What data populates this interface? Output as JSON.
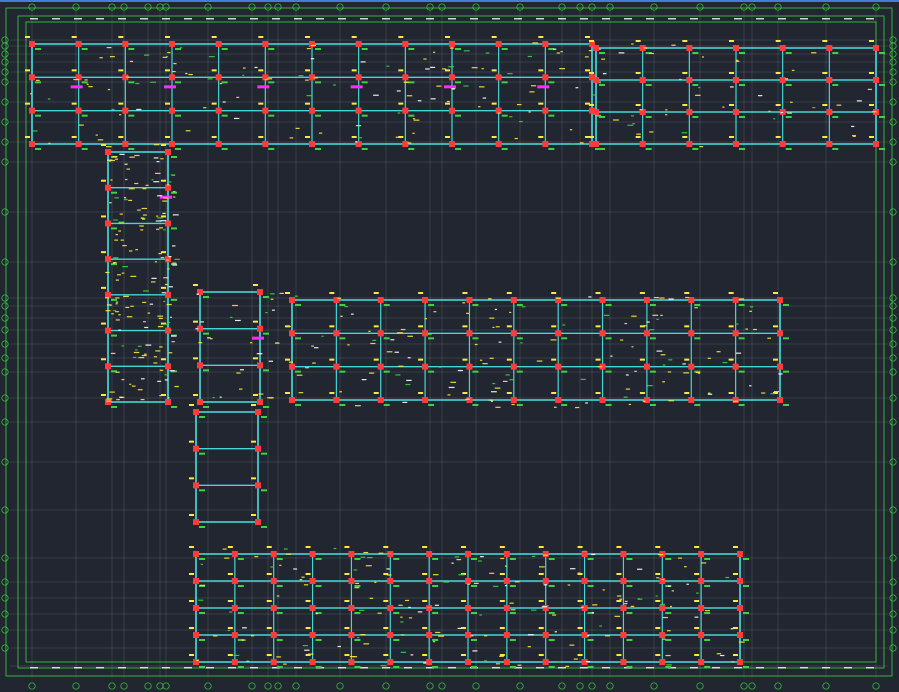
{
  "app": {
    "accent": "#3f7fd8",
    "background": "#212630"
  },
  "drawing": {
    "title": "",
    "colors": {
      "axis": "#39d43f",
      "grid": "#8a8f98",
      "beam": "#46d6d6",
      "column": "#ff3a3a",
      "rebar_label": "#ffe640",
      "slab_label": "#ff2aff",
      "text": "#ffffff"
    },
    "top_axis_labels": [
      "1",
      "2",
      "3",
      "4",
      "5",
      "6",
      "7",
      "8",
      "9",
      "10",
      "11",
      "12",
      "13",
      "14",
      "15",
      "16",
      "17",
      "18",
      "19",
      "20",
      "21",
      "22",
      "23",
      "24",
      "25",
      "26",
      "27",
      "28",
      "29"
    ],
    "side_axis_labels": [
      "A",
      "B",
      "C",
      "D",
      "E",
      "F",
      "G",
      "H",
      "J",
      "K",
      "L",
      "M",
      "N",
      "P",
      "Q",
      "R",
      "S",
      "T"
    ]
  }
}
